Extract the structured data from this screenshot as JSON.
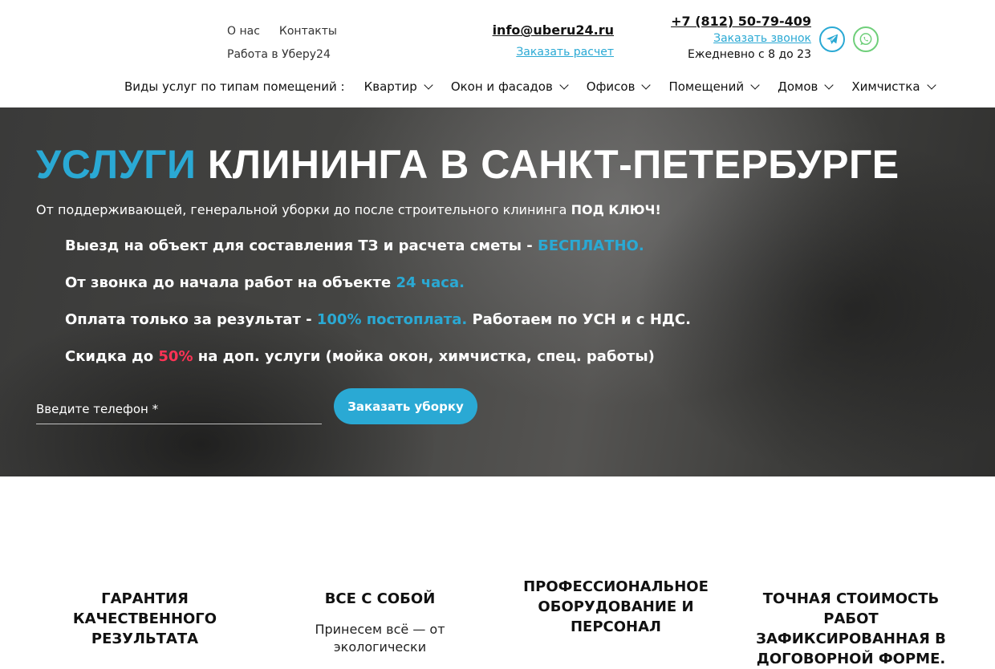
{
  "header": {
    "links": {
      "about": "О нас",
      "contacts": "Контакты",
      "work": "Работа в Уберу24"
    },
    "email": "info@uberu24.ru",
    "calc_link": "Заказать расчет",
    "phone": "+7 (812) 50-79-409",
    "callback": "Заказать звонок",
    "hours": "Ежедневно с 8 до 23",
    "social_icons": [
      "telegram-icon",
      "whatsapp-icon"
    ],
    "colors": {
      "accent": "#2aa9d4",
      "whatsapp": "#6fcf7a"
    }
  },
  "nav": {
    "lead": "Виды услуг по типам помещений :",
    "items": [
      {
        "label": "Квартир"
      },
      {
        "label": "Окон и фасадов"
      },
      {
        "label": "Офисов"
      },
      {
        "label": "Помещений"
      },
      {
        "label": "Домов"
      },
      {
        "label": "Химчистка"
      }
    ]
  },
  "hero": {
    "title_accent": "УСЛУГИ",
    "title_rest": "КЛИНИНГА В САНКТ-ПЕТЕРБУРГЕ",
    "subtitle": "От поддерживающей, генеральной уборки до после строительного клининга",
    "subtitle_bold": "ПОД КЛЮЧ!",
    "benefits": [
      {
        "text": "Выезд на объект для составления ТЗ и расчета сметы - ",
        "highlight": "БЕСПЛАТНО."
      },
      {
        "text": "От звонка до начала работ на объекте ",
        "highlight": "24 часа."
      },
      {
        "text": "Оплата только за результат - ",
        "highlight": "100% постоплата.",
        "tail": " Работаем по УСН и с НДС."
      },
      {
        "text": "Скидка до ",
        "highlight": "50%",
        "tail": " на доп. услуги (мойка окон, химчистка, спец. работы)"
      }
    ],
    "phone_placeholder": "Введите телефон *",
    "order_button": "Заказать уборку",
    "colors": {
      "highlight": "#2aa9d4",
      "discount": "#ff3355"
    }
  },
  "features": [
    {
      "title": "ГАРАНТИЯ КАЧЕСТВЕННОГО РЕЗУЛЬТАТА",
      "text": ""
    },
    {
      "title": "ВСЕ С СОБОЙ",
      "text": "Принесем всё — от экологически"
    },
    {
      "title": "ПРОФЕССИОНАЛЬНОЕ ОБОРУДОВАНИЕ И ПЕРСОНАЛ",
      "text": ""
    },
    {
      "title": "ТОЧНАЯ СТОИМОСТЬ РАБОТ ЗАФИКСИРОВАННАЯ В ДОГОВОРНОЙ ФОРМЕ.",
      "text": ""
    }
  ]
}
